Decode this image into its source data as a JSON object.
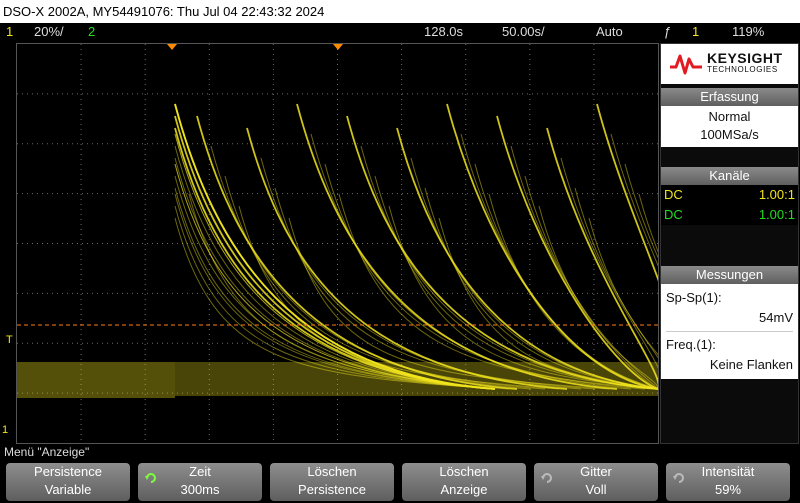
{
  "titlebar": {
    "text": "DSO-X 2002A, MY54491076: Thu Jul 04 22:43:32 2024"
  },
  "statusbar": {
    "ch1_num": "1",
    "ch1_scale": "20%/",
    "ch2_num": "2",
    "timebase_delay": "128.0s",
    "time_scale": "50.00s/",
    "trigger_mode": "Auto",
    "trigger_symbol": "ƒ",
    "trigger_source": "1",
    "trigger_level": "119%"
  },
  "left_markers": {
    "trigger_marker": "T",
    "ch1_ground_marker": "1"
  },
  "sidebar": {
    "logo": {
      "brand": "KEYSIGHT",
      "sub": "TECHNOLOGIES"
    },
    "acquisition": {
      "heading": "Erfassung",
      "mode": "Normal",
      "rate": "100MSa/s"
    },
    "channels": {
      "heading": "Kanäle",
      "rows": [
        {
          "coupling": "DC",
          "probe": "1.00:1",
          "color": "#f2e51d"
        },
        {
          "coupling": "DC",
          "probe": "1.00:1",
          "color": "#22dd22"
        }
      ]
    },
    "measurements": {
      "heading": "Messungen",
      "m1_label": "Sp-Sp(1):",
      "m1_value": "54mV",
      "m2_label": "Freq.(1):",
      "m2_value": "Keine Flanken"
    }
  },
  "menu": {
    "title": "Menü \"Anzeige\""
  },
  "softkeys": [
    {
      "line1": "Persistence",
      "line2": "Variable"
    },
    {
      "line1": "Zeit",
      "line2": "300ms"
    },
    {
      "line1": "Löschen",
      "line2": "Persistence"
    },
    {
      "line1": "Löschen",
      "line2": "Anzeige"
    },
    {
      "line1": "Gitter",
      "line2": "Voll"
    },
    {
      "line1": "Intensität",
      "line2": "59%"
    }
  ],
  "colors": {
    "ch1": "#f2e51d",
    "ch2": "#22dd22",
    "trigger_level_line": "#ff7a1a",
    "grid": "#6a6a6a"
  },
  "icons": {
    "rotary_knob": "rotary-knob-icon",
    "logo": "keysight-wave-logo"
  }
}
